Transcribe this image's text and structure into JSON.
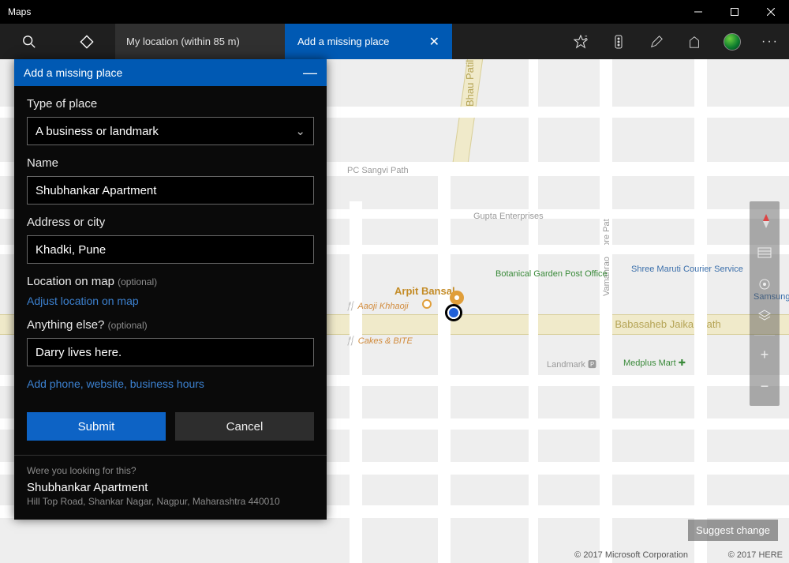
{
  "app": {
    "title": "Maps"
  },
  "toolbar": {
    "locationTab": "My location (within 85 m)",
    "addTab": "Add a missing place"
  },
  "panel": {
    "title": "Add a missing place",
    "typeLabel": "Type of place",
    "typeValue": "A business or landmark",
    "nameLabel": "Name",
    "nameValue": "Shubhankar Apartment",
    "addressLabel": "Address or city",
    "addressValue": "Khadki, Pune",
    "locationLabel": "Location on map",
    "optional": "(optional)",
    "adjustLink": "Adjust location on map",
    "anythingLabel": "Anything else?",
    "anythingValue": "Darry lives here.",
    "moreInfoLink": "Add phone, website, business hours",
    "submit": "Submit",
    "cancel": "Cancel",
    "lookingFor": "Were you looking for this?",
    "suggestionTitle": "Shubhankar Apartment",
    "suggestionAddr": "Hill Top Road, Shankar Nagar, Nagpur, Maharashtra 440010"
  },
  "map": {
    "roads": {
      "bhau": "Bhau Patil Roa",
      "sangvi": "PC Sangvi Path",
      "vamanrao": "Vamanrao More Path",
      "jaikar": "Dr Babasaheb Jaikar Path"
    },
    "poi": {
      "title": "Arpit Bansal",
      "aaoji": "Aaoji Khhaoji",
      "cakes": "Cakes & BITE",
      "gupta": "Gupta Enterprises",
      "botanical": "Botanical Garden Post Office",
      "shree": "Shree Maruti Courier Service",
      "samsung": "Samsung Service Center",
      "landmark": "Landmark",
      "medplus": "Medplus Mart"
    },
    "suggestChange": "Suggest change",
    "attr1": "© 2017 Microsoft Corporation",
    "attr2": "© 2017 HERE"
  }
}
